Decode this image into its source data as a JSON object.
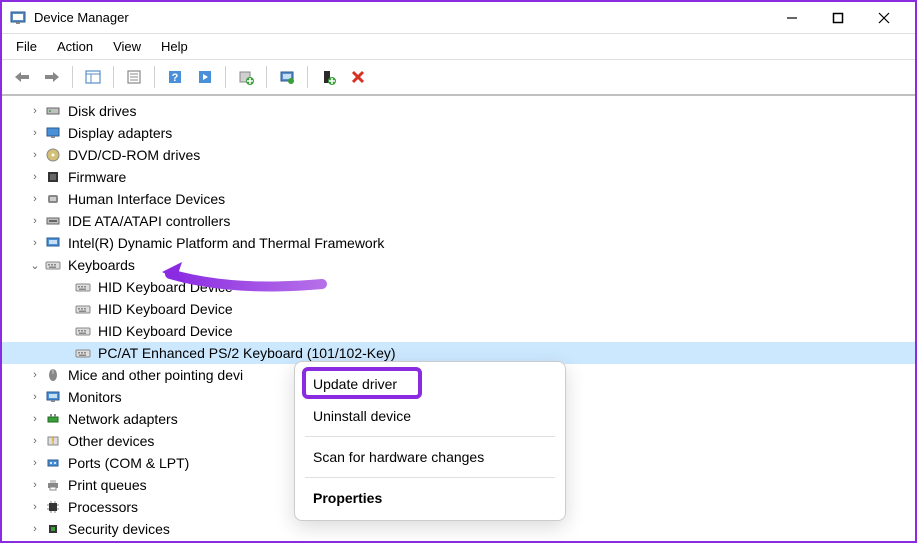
{
  "window": {
    "title": "Device Manager"
  },
  "menu": {
    "items": [
      "File",
      "Action",
      "View",
      "Help"
    ]
  },
  "tree": {
    "items": [
      {
        "label": "Disk drives",
        "icon": "diskdrive",
        "expanded": false
      },
      {
        "label": "Display adapters",
        "icon": "display",
        "expanded": false
      },
      {
        "label": "DVD/CD-ROM drives",
        "icon": "dvd",
        "expanded": false
      },
      {
        "label": "Firmware",
        "icon": "firmware",
        "expanded": false
      },
      {
        "label": "Human Interface Devices",
        "icon": "hid",
        "expanded": false
      },
      {
        "label": "IDE ATA/ATAPI controllers",
        "icon": "ide",
        "expanded": false
      },
      {
        "label": "Intel(R) Dynamic Platform and Thermal Framework",
        "icon": "intel",
        "expanded": false
      },
      {
        "label": "Keyboards",
        "icon": "keyboard",
        "expanded": true,
        "children": [
          {
            "label": "HID Keyboard Device",
            "icon": "keyboard"
          },
          {
            "label": "HID Keyboard Device",
            "icon": "keyboard"
          },
          {
            "label": "HID Keyboard Device",
            "icon": "keyboard"
          },
          {
            "label": "PC/AT Enhanced PS/2 Keyboard (101/102-Key)",
            "icon": "keyboard",
            "selected": true
          }
        ]
      },
      {
        "label": "Mice and other pointing devi",
        "icon": "mouse",
        "expanded": false
      },
      {
        "label": "Monitors",
        "icon": "monitor",
        "expanded": false
      },
      {
        "label": "Network adapters",
        "icon": "network",
        "expanded": false
      },
      {
        "label": "Other devices",
        "icon": "other",
        "expanded": false
      },
      {
        "label": "Ports (COM & LPT)",
        "icon": "port",
        "expanded": false
      },
      {
        "label": "Print queues",
        "icon": "printer",
        "expanded": false
      },
      {
        "label": "Processors",
        "icon": "processor",
        "expanded": false
      },
      {
        "label": "Security devices",
        "icon": "security",
        "expanded": false
      }
    ]
  },
  "context_menu": {
    "items": [
      {
        "label": "Update driver",
        "highlighted": true
      },
      {
        "label": "Uninstall device"
      },
      {
        "sep": true
      },
      {
        "label": "Scan for hardware changes"
      },
      {
        "sep": true
      },
      {
        "label": "Properties",
        "bold": true
      }
    ]
  }
}
